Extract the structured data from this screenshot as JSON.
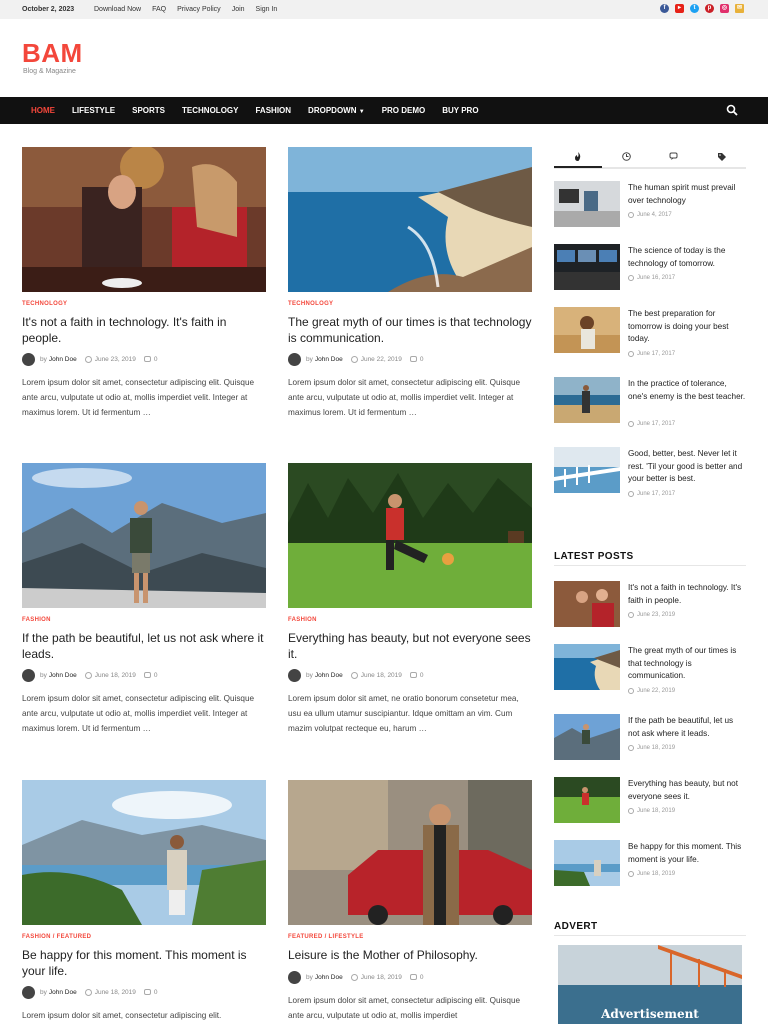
{
  "topbar": {
    "date": "October 2, 2023",
    "links": [
      "Download Now",
      "FAQ",
      "Privacy Policy",
      "Join",
      "Sign In"
    ],
    "social_icons": [
      "facebook-icon",
      "youtube-icon",
      "twitter-icon",
      "pinterest-icon",
      "instagram-icon",
      "email-icon"
    ]
  },
  "brand": {
    "logo": "BAM",
    "tagline": "Blog & Magazine",
    "accent_color": "#f3473b"
  },
  "nav": {
    "items": [
      "HOME",
      "LIFESTYLE",
      "SPORTS",
      "TECHNOLOGY",
      "FASHION",
      "DROPDOWN",
      "PRO DEMO",
      "BUY PRO"
    ],
    "active_index": 0
  },
  "posts": [
    {
      "category": "TECHNOLOGY",
      "title": "It's not a faith in technology. It's faith in people.",
      "author_prefix": "by",
      "author": "John Doe",
      "date": "June 23, 2019",
      "comments": "0",
      "excerpt": "Lorem ipsum dolor sit amet, consectetur adipiscing elit. Quisque ante arcu, vulputate ut odio at, mollis imperdiet velit. Integer at maximus lorem. Ut id fermentum …"
    },
    {
      "category": "TECHNOLOGY",
      "title": "The great myth of our times is that technology is communication.",
      "author_prefix": "by",
      "author": "John Doe",
      "date": "June 22, 2019",
      "comments": "0",
      "excerpt": "Lorem ipsum dolor sit amet, consectetur adipiscing elit. Quisque ante arcu, vulputate ut odio at, mollis imperdiet velit. Integer at maximus lorem. Ut id fermentum …"
    },
    {
      "category": "FASHION",
      "title": "If the path be beautiful, let us not ask where it leads.",
      "author_prefix": "by",
      "author": "John Doe",
      "date": "June 18, 2019",
      "comments": "0",
      "excerpt": "Lorem ipsum dolor sit amet, consectetur adipiscing elit. Quisque ante arcu, vulputate ut odio at, mollis imperdiet velit. Integer at maximus lorem. Ut id fermentum …"
    },
    {
      "category": "FASHION",
      "title": "Everything has beauty, but not everyone sees it.",
      "author_prefix": "by",
      "author": "John Doe",
      "date": "June 18, 2019",
      "comments": "0",
      "excerpt": "Lorem ipsum dolor sit amet, ne oratio bonorum consetetur mea, usu ea ullum utamur suscipiantur. Idque omittam an vim. Cum mazim volutpat recteque eu, harum …"
    },
    {
      "category": "FASHION / FEATURED",
      "title": "Be happy for this moment. This moment is your life.",
      "author_prefix": "by",
      "author": "John Doe",
      "date": "June 18, 2019",
      "comments": "0",
      "excerpt": "Lorem ipsum dolor sit amet, consectetur adipiscing elit."
    },
    {
      "category": "FEATURED / LIFESTYLE",
      "title": "Leisure is the Mother of Philosophy.",
      "author_prefix": "by",
      "author": "John Doe",
      "date": "June 18, 2019",
      "comments": "0",
      "excerpt": "Lorem ipsum dolor sit amet, consectetur adipiscing elit. Quisque ante arcu, vulputate ut odio at, mollis imperdiet"
    }
  ],
  "sidebar": {
    "tab_icons": [
      "flame-icon",
      "clock-icon",
      "comments-icon",
      "tags-icon"
    ],
    "popular": [
      {
        "title": "The human spirit must prevail over technology",
        "date": "June 4, 2017"
      },
      {
        "title": "The science of today is the technology of tomorrow.",
        "date": "June 16, 2017"
      },
      {
        "title": "The best preparation for tomorrow is doing your best today.",
        "date": "June 17, 2017"
      },
      {
        "title": "In the practice of tolerance, one's enemy is the best teacher.",
        "date": "June 17, 2017"
      },
      {
        "title": "Good, better, best. Never let it rest. 'Til your good is better and your better is best.",
        "date": "June 17, 2017"
      }
    ],
    "latest_heading": "LATEST POSTS",
    "latest": [
      {
        "title": "It's not a faith in technology. It's faith in people.",
        "date": "June 23, 2019"
      },
      {
        "title": "The great myth of our times is that technology is communication.",
        "date": "June 22, 2019"
      },
      {
        "title": "If the path be beautiful, let us not ask where it leads.",
        "date": "June 18, 2019"
      },
      {
        "title": "Everything has beauty, but not everyone sees it.",
        "date": "June 18, 2019"
      },
      {
        "title": "Be happy for this moment. This moment is your life.",
        "date": "June 18, 2019"
      }
    ],
    "advert_heading": "ADVERT",
    "advert_text": "Advertisement"
  }
}
